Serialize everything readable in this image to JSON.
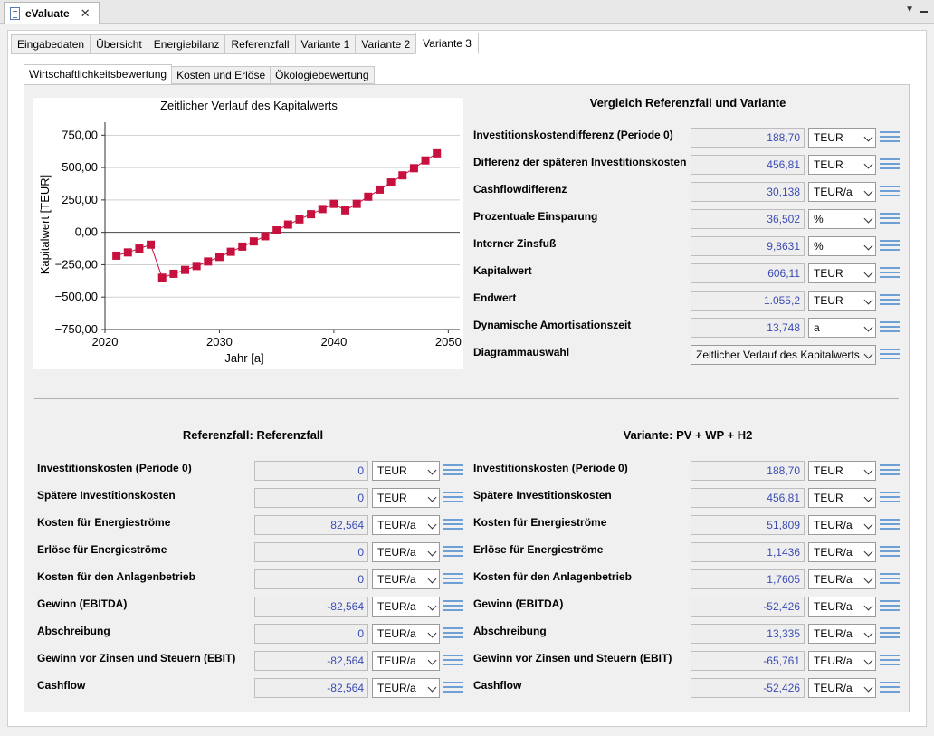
{
  "window": {
    "title": "eValuate"
  },
  "tabs": [
    "Eingabedaten",
    "Übersicht",
    "Energiebilanz",
    "Referenzfall",
    "Variante 1",
    "Variante 2",
    "Variante 3"
  ],
  "active_tab": "Variante 3",
  "sub_tabs": [
    "Wirtschaftlichkeitsbewertung",
    "Kosten und Erlöse",
    "Ökologiebewertung"
  ],
  "active_sub_tab": "Wirtschaftlichkeitsbewertung",
  "chart_data": {
    "type": "line",
    "title": "Zeitlicher Verlauf des Kapitalwerts",
    "xlabel": "Jahr [a]",
    "ylabel": "Kapitalwert [TEUR]",
    "xlim": [
      2020,
      2051
    ],
    "ylim": [
      -750,
      850
    ],
    "xticks": [
      "2020",
      "2030",
      "2040",
      "2050"
    ],
    "yticks": [
      "750,00",
      "500,00",
      "250,00",
      "0,00",
      "−250,00",
      "−500,00",
      "−750,00"
    ],
    "ytick_values": [
      750,
      500,
      250,
      0,
      -250,
      -500,
      -750
    ],
    "xtick_values": [
      2020,
      2030,
      2040,
      2050
    ],
    "grid": true,
    "marker_color": "#c8103f",
    "x": [
      2021,
      2022,
      2023,
      2024,
      2025,
      2026,
      2027,
      2028,
      2029,
      2030,
      2031,
      2032,
      2033,
      2034,
      2035,
      2036,
      2037,
      2038,
      2039,
      2040,
      2041,
      2042,
      2043,
      2044,
      2045,
      2046,
      2047,
      2048,
      2049
    ],
    "y": [
      -180,
      -155,
      -125,
      -95,
      -350,
      -320,
      -290,
      -260,
      -225,
      -190,
      -150,
      -110,
      -70,
      -30,
      15,
      60,
      100,
      140,
      180,
      220,
      170,
      220,
      275,
      330,
      385,
      440,
      495,
      555,
      610
    ]
  },
  "comparison": {
    "title": "Vergleich Referenzfall und Variante",
    "rows": [
      {
        "label": "Investitionskostendifferenz (Periode 0)",
        "value": "188,70",
        "unit": "TEUR"
      },
      {
        "label": "Differenz der späteren Investitionskosten",
        "value": "456,81",
        "unit": "TEUR"
      },
      {
        "label": "Cashflowdifferenz",
        "value": "30,138",
        "unit": "TEUR/a"
      },
      {
        "label": "Prozentuale Einsparung",
        "value": "36,502",
        "unit": "%"
      },
      {
        "label": "Interner Zinsfuß",
        "value": "9,8631",
        "unit": "%"
      },
      {
        "label": "Kapitalwert",
        "value": "606,11",
        "unit": "TEUR"
      },
      {
        "label": "Endwert",
        "value": "1.055,2",
        "unit": "TEUR"
      },
      {
        "label": "Dynamische Amortisationszeit",
        "value": "13,748",
        "unit": "a"
      }
    ],
    "diagram_label": "Diagrammauswahl",
    "diagram_value": "Zeitlicher Verlauf des Kapitalwerts"
  },
  "reference": {
    "title": "Referenzfall: Referenzfall",
    "rows": [
      {
        "label": "Investitionskosten (Periode 0)",
        "value": "0",
        "unit": "TEUR"
      },
      {
        "label": "Spätere Investitionskosten",
        "value": "0",
        "unit": "TEUR"
      },
      {
        "label": "Kosten für Energieströme",
        "value": "82,564",
        "unit": "TEUR/a"
      },
      {
        "label": "Erlöse für Energieströme",
        "value": "0",
        "unit": "TEUR/a"
      },
      {
        "label": "Kosten für den Anlagenbetrieb",
        "value": "0",
        "unit": "TEUR/a"
      },
      {
        "label": "Gewinn (EBITDA)",
        "value": "-82,564",
        "unit": "TEUR/a"
      },
      {
        "label": "Abschreibung",
        "value": "0",
        "unit": "TEUR/a"
      },
      {
        "label": "Gewinn vor Zinsen und Steuern (EBIT)",
        "value": "-82,564",
        "unit": "TEUR/a"
      },
      {
        "label": "Cashflow",
        "value": "-82,564",
        "unit": "TEUR/a"
      }
    ]
  },
  "variant": {
    "title": "Variante: PV + WP + H2",
    "rows": [
      {
        "label": "Investitionskosten (Periode 0)",
        "value": "188,70",
        "unit": "TEUR"
      },
      {
        "label": "Spätere Investitionskosten",
        "value": "456,81",
        "unit": "TEUR"
      },
      {
        "label": "Kosten für Energieströme",
        "value": "51,809",
        "unit": "TEUR/a"
      },
      {
        "label": "Erlöse für Energieströme",
        "value": "1,1436",
        "unit": "TEUR/a"
      },
      {
        "label": "Kosten für den Anlagenbetrieb",
        "value": "1,7605",
        "unit": "TEUR/a"
      },
      {
        "label": "Gewinn (EBITDA)",
        "value": "-52,426",
        "unit": "TEUR/a"
      },
      {
        "label": "Abschreibung",
        "value": "13,335",
        "unit": "TEUR/a"
      },
      {
        "label": "Gewinn vor Zinsen und Steuern (EBIT)",
        "value": "-65,761",
        "unit": "TEUR/a"
      },
      {
        "label": "Cashflow",
        "value": "-52,426",
        "unit": "TEUR/a"
      }
    ]
  }
}
